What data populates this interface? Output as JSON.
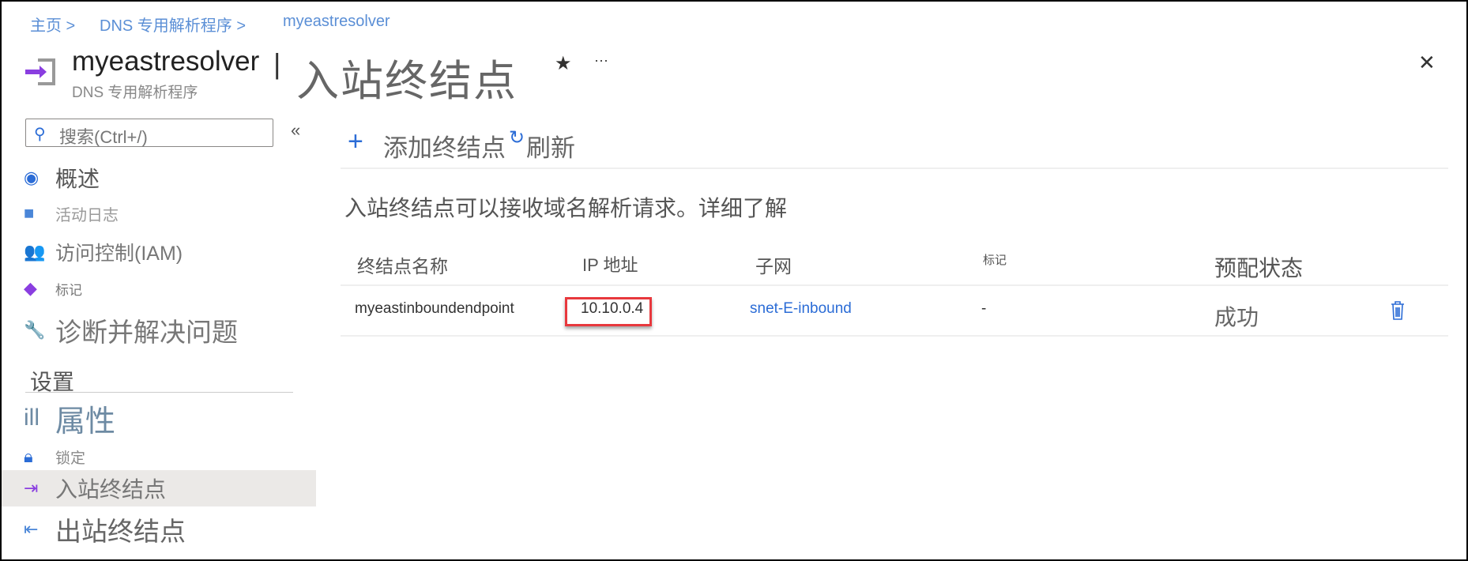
{
  "breadcrumb": {
    "home": "主页 >",
    "parent": "DNS 专用解析程序 >",
    "current": "myeastresolver"
  },
  "header": {
    "resource": "myeastresolver",
    "separator": "|",
    "page": "入站终结点",
    "subtitle": "DNS 专用解析程序",
    "star": "★",
    "more": "···",
    "close": "✕"
  },
  "sidebar": {
    "search_placeholder": "搜索(Ctrl+/)",
    "collapse": "«",
    "items": [
      {
        "label": "概述"
      },
      {
        "label": "活动日志"
      },
      {
        "label": "访问控制(IAM)"
      },
      {
        "label": "标记"
      },
      {
        "label": "诊断并解决问题"
      }
    ],
    "section": "设置",
    "settings": [
      {
        "label": "属性",
        "icon": "ill"
      },
      {
        "label": "锁定"
      },
      {
        "label": "入站终结点"
      },
      {
        "label": "出站终结点"
      }
    ]
  },
  "toolbar": {
    "add": "添加终结点",
    "refresh": "刷新"
  },
  "description": {
    "text": "入站终结点可以接收域名解析请求。",
    "link": "详细了解"
  },
  "table": {
    "headers": [
      "终结点名称",
      "IP 地址",
      "子网",
      "标记",
      "预配状态"
    ],
    "rows": [
      {
        "name": "myeastinboundendpoint",
        "ip": "10.10.0.4",
        "subnet": "snet-E-inbound",
        "tags": "-",
        "status": "成功"
      }
    ]
  }
}
